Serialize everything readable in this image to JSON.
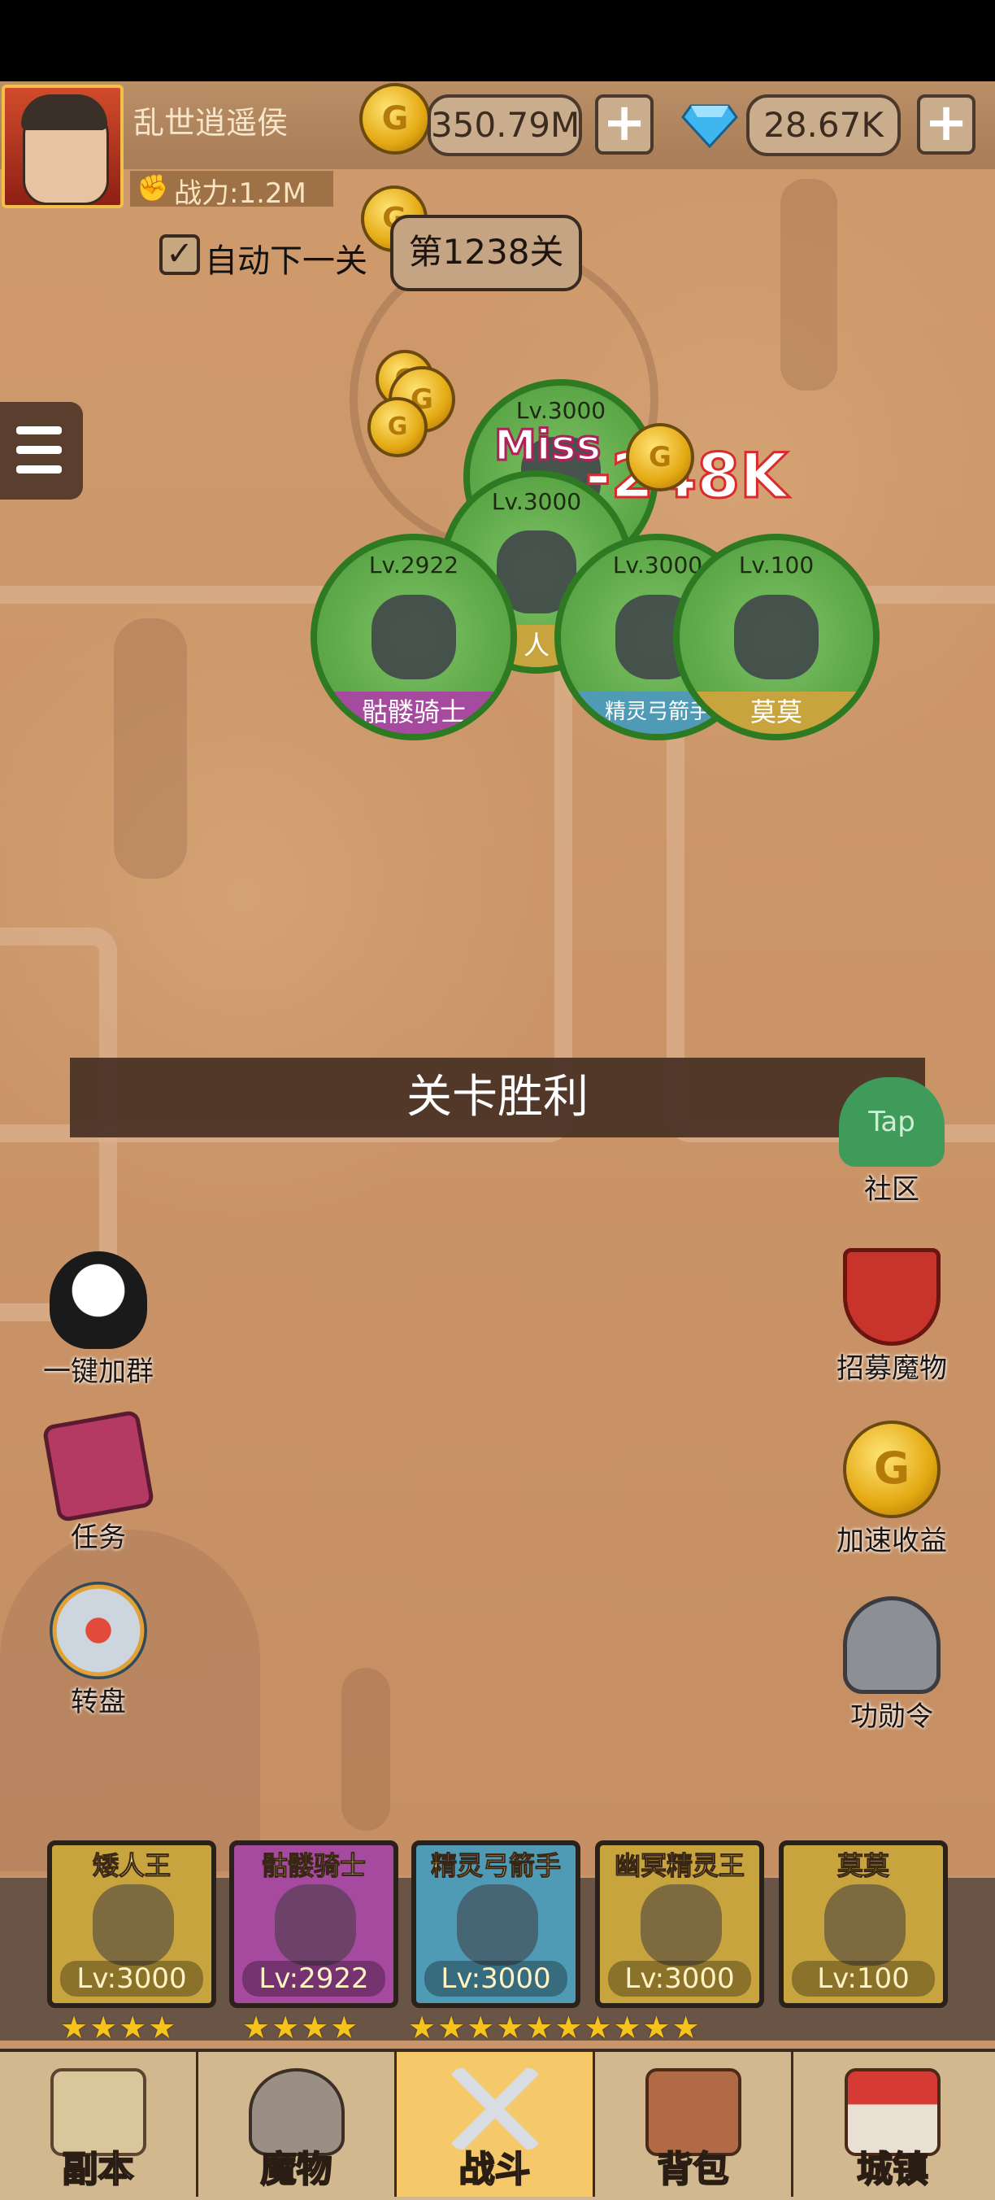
{
  "header": {
    "player_name": "乱世逍遥侯",
    "power": "战力:1.2M",
    "gold": "350.79M",
    "gems": "28.67K",
    "plus": "+"
  },
  "stage": {
    "auto_next_label": "自动下一关",
    "auto_next_checked": "✓",
    "stage_label": "第1238关"
  },
  "battle": {
    "miss": "Miss",
    "damage": "-248K",
    "heroes": [
      {
        "lv": "Lv.3000",
        "name": ""
      },
      {
        "lv": "Lv.3000",
        "name": "人"
      },
      {
        "lv": "Lv.2922",
        "name": "骷髅骑士"
      },
      {
        "lv": "Lv.3000",
        "name": "精灵弓箭手"
      },
      {
        "lv": "Lv.100",
        "name": "莫莫"
      }
    ]
  },
  "victory": "关卡胜利",
  "side_left": [
    {
      "label": "一键加群",
      "icon": "penguin-icon"
    },
    {
      "label": "任务",
      "icon": "book-icon"
    },
    {
      "label": "转盘",
      "icon": "wheel-icon"
    }
  ],
  "side_right": [
    {
      "label": "社区",
      "icon": "tap-community-icon",
      "badge": "Tap"
    },
    {
      "label": "招募魔物",
      "icon": "banner-shield-icon"
    },
    {
      "label": "加速收益",
      "icon": "coin-arrow-icon"
    },
    {
      "label": "功勋令",
      "icon": "helmet-icon"
    }
  ],
  "roster": [
    {
      "name": "矮人王",
      "lv": "Lv:3000",
      "stars": "★★★★",
      "color": "#c7a43d"
    },
    {
      "name": "骷髅骑士",
      "lv": "Lv:2922",
      "stars": "★★★★",
      "color": "#a64aa0"
    },
    {
      "name": "精灵弓箭手",
      "lv": "Lv:3000",
      "stars": "★★★★★★★★★★",
      "color": "#4f9ab5"
    },
    {
      "name": "幽冥精灵王",
      "lv": "Lv:3000",
      "stars": "",
      "color": "#c7a43d"
    },
    {
      "name": "莫莫",
      "lv": "Lv:100",
      "stars": "",
      "color": "#c7a43d"
    }
  ],
  "nav": [
    {
      "label": "副本",
      "icon": "map-icon"
    },
    {
      "label": "魔物",
      "icon": "monster-helmet-icon"
    },
    {
      "label": "战斗",
      "icon": "crossed-swords-icon"
    },
    {
      "label": "背包",
      "icon": "backpack-icon"
    },
    {
      "label": "城镇",
      "icon": "town-icon"
    }
  ]
}
